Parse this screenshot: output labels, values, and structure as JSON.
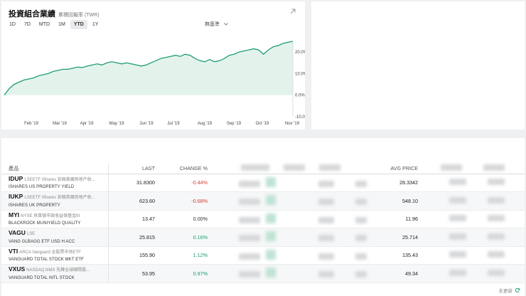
{
  "performance": {
    "title": "投資組合業績",
    "subtitle": "累積回報率 (TWR)",
    "ranges": [
      "1D",
      "7D",
      "MTD",
      "1M",
      "YTD",
      "1Y"
    ],
    "active_range": "YTD",
    "benchmark_label": "無基準",
    "icons": {
      "expand": "expand-arrow-icon",
      "benchmark_toggle": "chevron-down-icon"
    },
    "colors": {
      "line": "#1e9d74",
      "area": "#e3f3ec"
    }
  },
  "chart_data": {
    "type": "area",
    "x_labels": [
      "Feb '19",
      "Mar '19",
      "Apr '19",
      "May '19",
      "Jun '19",
      "Jul '19",
      "Aug '19",
      "Sep '19",
      "Oct '19",
      "Nov '19"
    ],
    "y_ticks": [
      "20.0%",
      "10.0%",
      "0.0%",
      "-10.0%"
    ],
    "ylim": [
      -10,
      25
    ],
    "series": [
      {
        "values": [
          0,
          3,
          5,
          6,
          7,
          7.5,
          8,
          9,
          9.5,
          10,
          11,
          11.5,
          12,
          12,
          12.5,
          13,
          12.8,
          13.5,
          14,
          14.5,
          14,
          15,
          15.5,
          15,
          14.5,
          15,
          14.5,
          14,
          13.5,
          14,
          15,
          16,
          17,
          17.5,
          18,
          18.5,
          18,
          19,
          18.5,
          17,
          16,
          15.5,
          16.5,
          15.5,
          16,
          17,
          18.5,
          19,
          20,
          20.5,
          21,
          21.5,
          21,
          19,
          21,
          22.5,
          23,
          24,
          24.5,
          25
        ]
      }
    ]
  },
  "holdings": {
    "columns": {
      "product": "產品",
      "last": "LAST",
      "change": "CHANGE %",
      "avg_price": "AVG PRICE"
    },
    "rows": [
      {
        "symbol": "IDUP",
        "exchange": "LSEETF iShares 安碩美國房地产收...",
        "name": "ISHARES US PROPERTY YIELD",
        "last": "31.8300",
        "change": "-0.44%",
        "dir": "neg",
        "avg": "28.3342"
      },
      {
        "symbol": "IUKP",
        "exchange": "LSEETF iShares 安碩英國房地产收...",
        "name": "ISHARES UK PROPERTY",
        "last": "623.60",
        "change": "-0.68%",
        "dir": "neg",
        "avg": "548.10"
      },
      {
        "symbol": "MYI",
        "exchange": "NYSE 貝萊德市政收益保基金III",
        "name": "BLACKROCK MUNIYIELD QUALITY",
        "last": "13.47",
        "change": "0.00%",
        "dir": "zero",
        "avg": "11.96"
      },
      {
        "symbol": "VAGU",
        "exchange": "LSE",
        "name": "VANG GLBAGG ETF USD H ACC",
        "last": "25.815",
        "change": "0.16%",
        "dir": "pos",
        "avg": "25.714"
      },
      {
        "symbol": "VTI",
        "exchange": "ARCA Vanguard 全股票市场ETF",
        "name": "VANGUARD TOTAL STOCK MKT ETF",
        "last": "155.90",
        "change": "1.12%",
        "dir": "pos",
        "avg": "135.43"
      },
      {
        "symbol": "VXUS",
        "exchange": "NASDAQ.NMS 先鋒全球國際股...",
        "name": "VANGUARD TOTAL INTL STOCK",
        "last": "53.95",
        "change": "0.97%",
        "dir": "pos",
        "avg": "49.34"
      }
    ],
    "footer_text": "未更新",
    "footer_icon": "refresh-icon"
  }
}
